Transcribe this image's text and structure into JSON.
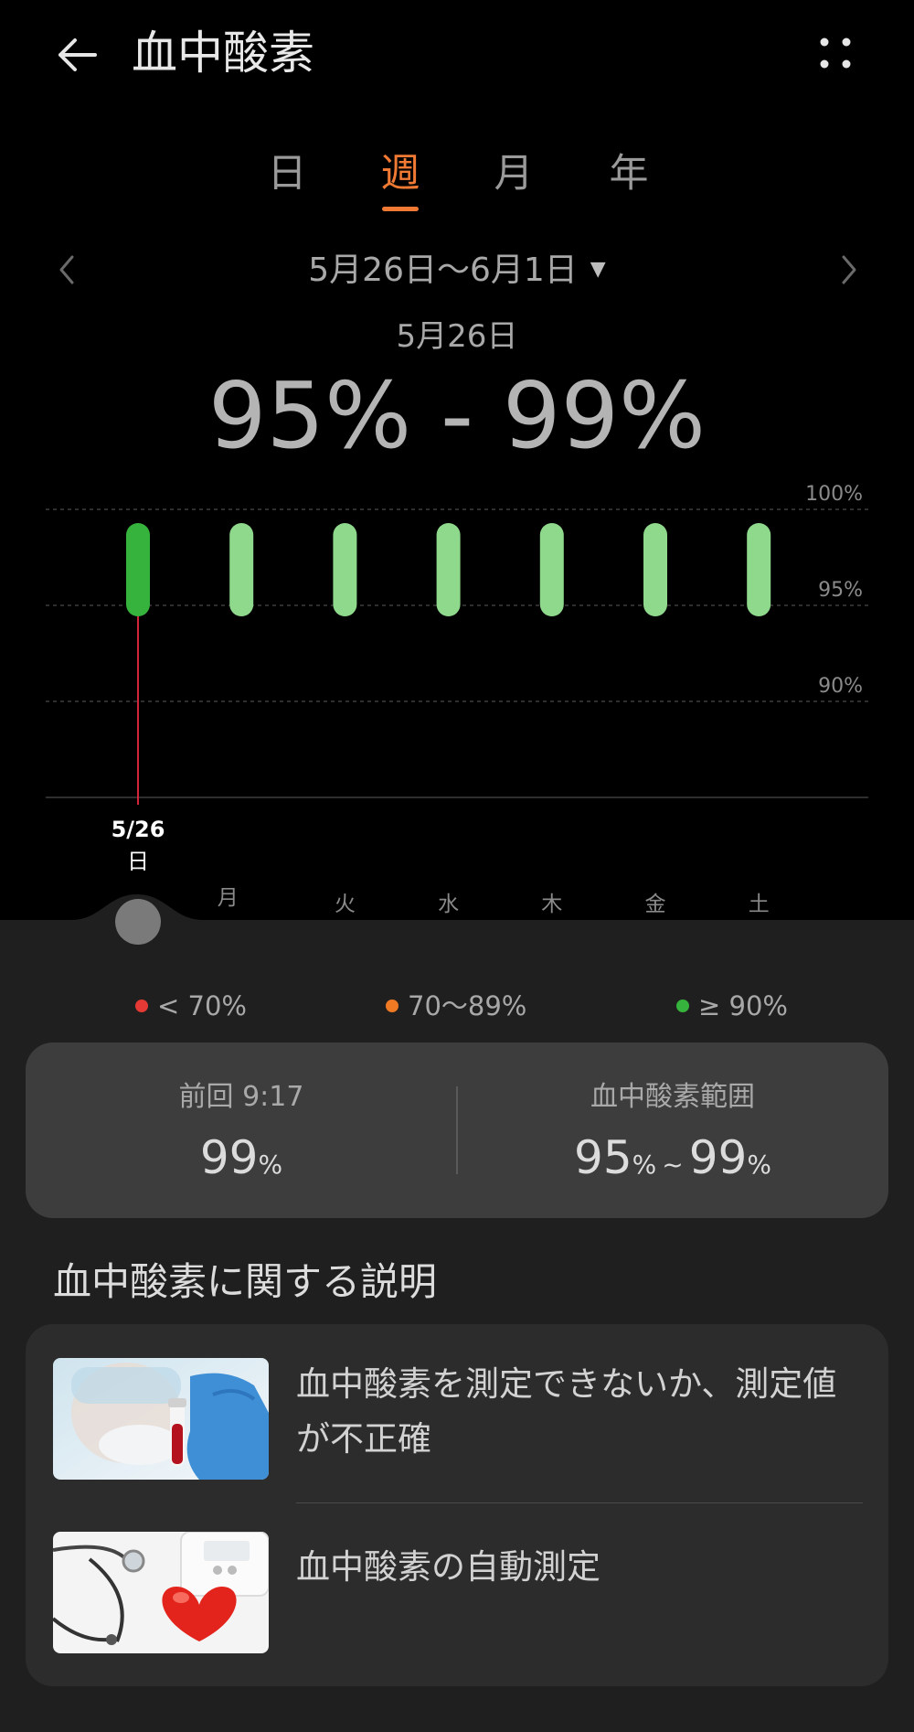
{
  "header": {
    "title": "血中酸素"
  },
  "tabs": [
    {
      "label": "日",
      "active": false
    },
    {
      "label": "週",
      "active": true
    },
    {
      "label": "月",
      "active": false
    },
    {
      "label": "年",
      "active": false
    }
  ],
  "period": {
    "range": "5月26日〜6月1日",
    "selected_date": "5月26日",
    "value_range": "95% - 99%"
  },
  "chart_data": {
    "type": "bar",
    "categories": [
      "日",
      "月",
      "火",
      "水",
      "木",
      "金",
      "土"
    ],
    "selected_index": 0,
    "selected_label": "5/26",
    "series": [
      {
        "low": [
          95,
          95,
          95,
          95,
          95,
          95,
          95
        ],
        "high": [
          99,
          99,
          99,
          99,
          99,
          99,
          99
        ]
      }
    ],
    "y_ticks": [
      {
        "value": 100,
        "label": "100%"
      },
      {
        "value": 95,
        "label": "95%"
      },
      {
        "value": 90,
        "label": "90%"
      }
    ],
    "ylim": [
      85,
      100
    ],
    "grid": true,
    "colors": {
      "bar": "#8fd98c",
      "selected_bar": "#36b33d",
      "marker_line": "#d2253b"
    }
  },
  "legend": [
    {
      "label": "< 70%",
      "color": "#e53935"
    },
    {
      "label": "70〜89%",
      "color": "#f07a24"
    },
    {
      "label": "≥ 90%",
      "color": "#36b33d"
    }
  ],
  "summary": {
    "last_label": "前回 9:17",
    "last_value": "99",
    "range_label": "血中酸素範囲",
    "range_low": "95",
    "range_high": "99",
    "unit": "%",
    "range_separator": "~"
  },
  "section_title": "血中酸素に関する説明",
  "articles": [
    {
      "text": "血中酸素を測定できないか、測定値が不正確"
    },
    {
      "text": "血中酸素の自動測定"
    }
  ],
  "colors": {
    "accent": "#f07a34",
    "card": "#3d3d3d",
    "background": "#1f1f1f"
  }
}
